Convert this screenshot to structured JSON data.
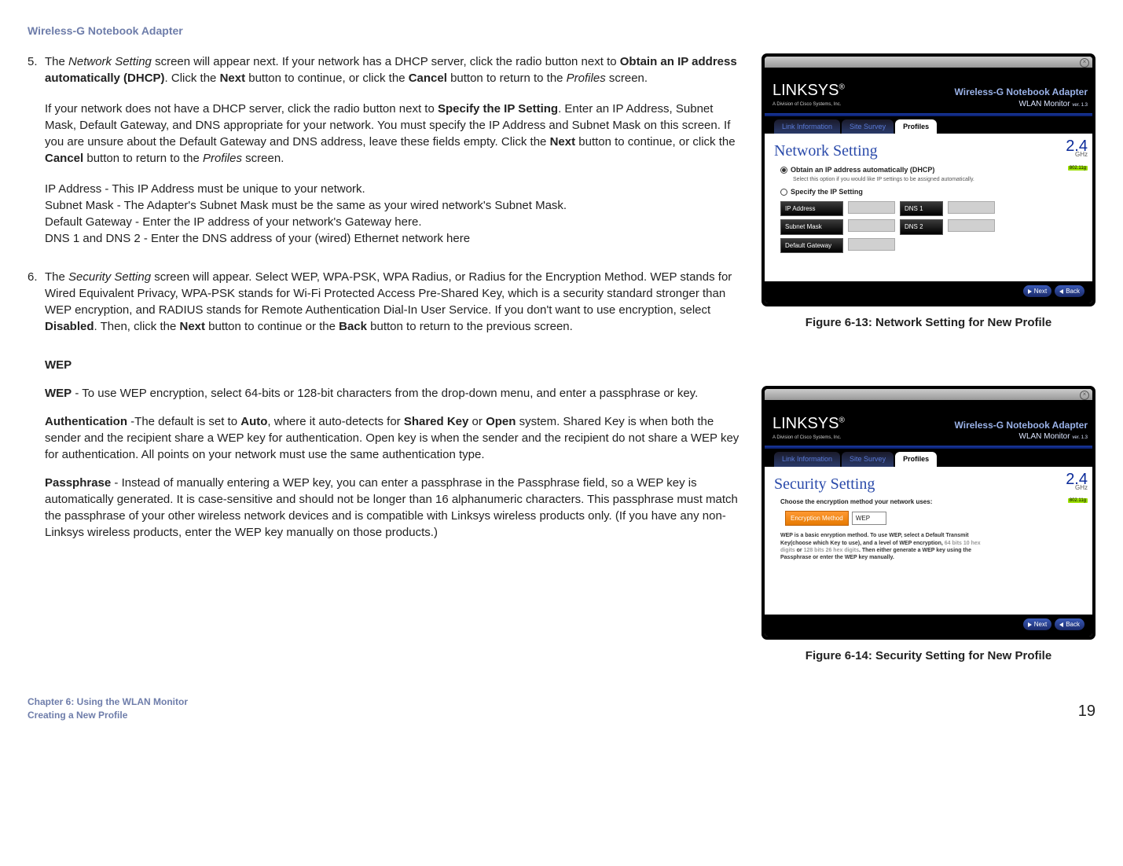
{
  "header": "Wireless-G Notebook Adapter",
  "step5": {
    "num": "5.",
    "p1a": "The ",
    "p1b": "Network Setting",
    "p1c": " screen will appear next. If your network has a DHCP server, click the radio button next to ",
    "p1d": "Obtain an IP address automatically (DHCP)",
    "p1e": ". Click the ",
    "p1f": "Next",
    "p1g": " button to continue, or click the ",
    "p1h": "Cancel",
    "p1i": " button to return to the ",
    "p1j": "Profiles",
    "p1k": " screen.",
    "p2a": "If your network does not have a DHCP server, click the radio button next to ",
    "p2b": "Specify the IP Setting",
    "p2c": ". Enter an IP Address, Subnet Mask, Default Gateway, and DNS appropriate for your network. You must specify the IP Address and Subnet Mask on this screen. If you are unsure about the Default Gateway and DNS address, leave these fields empty. Click the ",
    "p2d": "Next",
    "p2e": " button to continue, or click the ",
    "p2f": "Cancel",
    "p2g": " button to return to the ",
    "p2h": "Profiles",
    "p2i": " screen.",
    "line1": "IP Address - This IP Address must be unique to your network.",
    "line2": "Subnet Mask - The Adapter's Subnet Mask must be the same as your wired network's Subnet Mask.",
    "line3": "Default Gateway - Enter the IP address of your network's Gateway here.",
    "line4": "DNS 1 and DNS 2 - Enter the DNS address of your (wired) Ethernet network here"
  },
  "step6": {
    "num": "6.",
    "p1a": "The ",
    "p1b": "Security Setting",
    "p1c": " screen will appear. Select WEP, WPA-PSK, WPA Radius, or Radius for the Encryption Method. WEP stands for Wired Equivalent Privacy, WPA-PSK stands for Wi-Fi Protected Access Pre-Shared Key, which is a security standard stronger than WEP encryption, and RADIUS stands for Remote Authentication Dial-In User Service. If you don't want to use encryption, select ",
    "p1d": "Disabled",
    "p1e": ". Then, click the ",
    "p1f": "Next",
    "p1g": " button to continue or the ",
    "p1h": "Back",
    "p1i": " button to return to the previous screen."
  },
  "wep": {
    "heading": "WEP",
    "p1a": "WEP",
    "p1b": " - To use WEP encryption, select 64-bits or 128-bit characters from the drop-down menu, and enter a passphrase or key.",
    "p2a": "Authentication",
    "p2b": " -The default is set to ",
    "p2c": "Auto",
    "p2d": ", where it auto-detects for ",
    "p2e": "Shared Key",
    "p2f": " or ",
    "p2g": "Open",
    "p2h": " system.  Shared Key is when both the sender and the recipient share a WEP key for authentication. Open key is when the sender and the recipient do not share a WEP key for authentication. All points on your network must use the same authentication type.",
    "p3a": "Passphrase",
    "p3b": " - Instead of manually entering a WEP key, you can enter a passphrase in the Passphrase field, so a WEP key is automatically generated. It is case-sensitive and should not be longer than 16 alphanumeric characters. This passphrase must match the passphrase of your other wireless network devices and is compatible with Linksys wireless products only. (If you have any non-Linksys wireless products, enter the WEP key manually on those products.)"
  },
  "fig13": {
    "caption": "Figure 6-13: Network Setting for New Profile",
    "brand": "LINKSYS",
    "brandSub": "A Division of Cisco Systems, Inc.",
    "adapter": "Wireless-G Notebook Adapter",
    "wlan": "WLAN Monitor",
    "ver": "ver. 1.3",
    "tab1": "Link Information",
    "tab2": "Site Survey",
    "tab3": "Profiles",
    "title": "Network Setting",
    "opt1": "Obtain an IP address automatically (DHCP)",
    "opt1hint": "Select this option if you would like IP settings to be assigned automatically.",
    "opt2": "Specify the IP Setting",
    "ipaddr": "IP Address",
    "subnet": "Subnet Mask",
    "gateway": "Default Gateway",
    "dns1": "DNS 1",
    "dns2": "DNS 2",
    "band": "2.4",
    "ghz": "GHz",
    "std": "802.11g",
    "next": "Next",
    "back": "Back"
  },
  "fig14": {
    "caption": "Figure 6-14: Security Setting for New Profile",
    "title": "Security Setting",
    "choose": "Choose the encryption method your network uses:",
    "encLabel": "Encryption Method",
    "encVal": "WEP",
    "desc1": "WEP is a basic enryption method. To use WEP, select a Default Transmit Key(choose which Key to use), and a level of WEP encryption, ",
    "desc2": "64 bits 10 hex digits",
    "desc3": " or ",
    "desc4": "128 bits 26 hex digits",
    "desc5": ". Then either generate a WEP key using the Passphrase or enter the WEP key manually."
  },
  "footer": {
    "line1": "Chapter 6: Using the WLAN Monitor",
    "line2": "Creating a New Profile",
    "page": "19"
  }
}
